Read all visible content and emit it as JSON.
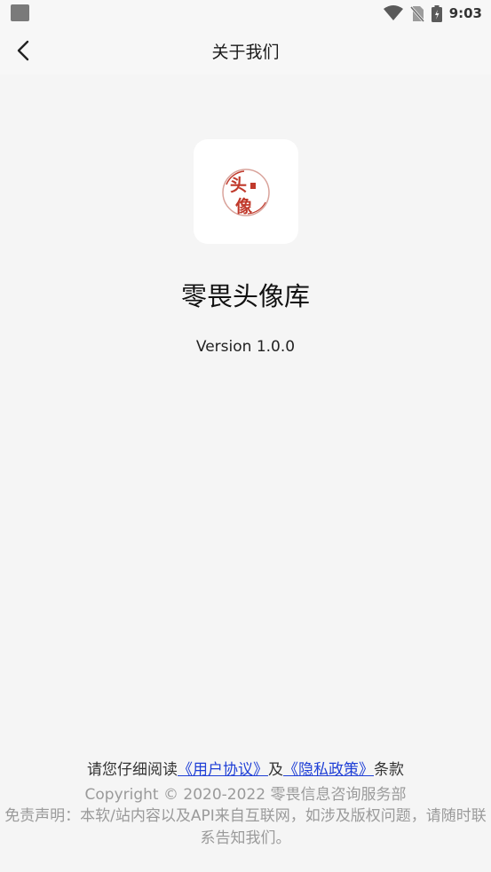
{
  "status_bar": {
    "time": "9:03",
    "icons": [
      "notification-icon",
      "wifi-icon",
      "no-sim-icon",
      "battery-icon"
    ]
  },
  "app_bar": {
    "back_icon": "back-arrow-icon",
    "title": "关于我们"
  },
  "about": {
    "logo_text": [
      "头",
      "像"
    ],
    "logo_color": "#c0392b",
    "app_name": "零畏头像库",
    "version": "Version 1.0.0"
  },
  "footer": {
    "agreement_prefix": "请您仔细阅读",
    "user_agreement": "《用户协议》",
    "conjunction": "及",
    "privacy_policy": "《隐私政策》",
    "agreement_suffix": "条款",
    "copyright": "Copyright © 2020-2022 零畏信息咨询服务部",
    "disclaimer": "免责声明：本软/站内容以及API来自互联网，如涉及版权问题，请随时联系告知我们。",
    "link_color": "#1f3fd6"
  }
}
